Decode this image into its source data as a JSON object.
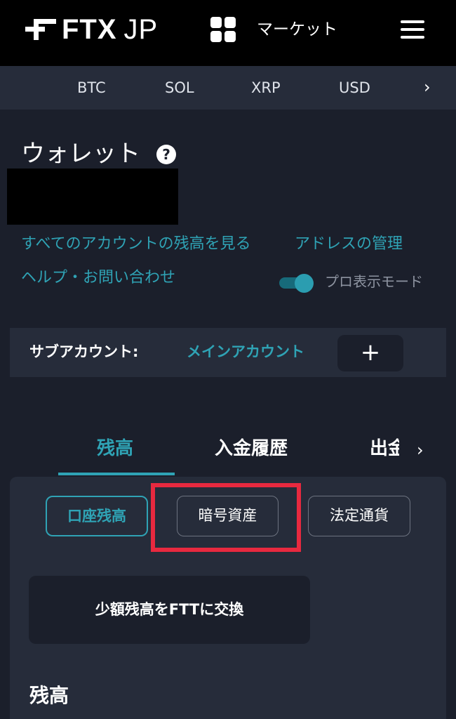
{
  "header": {
    "logo_text": "FTX",
    "logo_suffix": "JP",
    "market_label": "マーケット"
  },
  "ticker": {
    "items": [
      "BTC",
      "SOL",
      "XRP",
      "USD"
    ],
    "next_symbol": "›"
  },
  "wallet": {
    "title": "ウォレット",
    "help_symbol": "?"
  },
  "links": {
    "view_all_balances": "すべてのアカウントの残高を見る",
    "manage_addresses": "アドレスの管理",
    "help_contact": "ヘルプ・お問い合わせ"
  },
  "pro_mode": {
    "label": "プロ表示モード",
    "enabled": true
  },
  "subaccount": {
    "label": "サブアカウント:",
    "value": "メインアカウント",
    "add_symbol": "+"
  },
  "tabs": {
    "items": [
      {
        "label": "残高",
        "active": true
      },
      {
        "label": "入金履歴",
        "active": false
      },
      {
        "label": "出金",
        "active": false
      }
    ],
    "next_symbol": "›"
  },
  "filters": {
    "items": [
      {
        "label": "口座残高",
        "active": true
      },
      {
        "label": "暗号資産",
        "active": false
      },
      {
        "label": "法定通貨",
        "active": false
      }
    ]
  },
  "convert_button": "少額残高をFTTに交換",
  "balance_heading": "残高",
  "colors": {
    "accent": "#2fa3b5",
    "background": "#1b1f2b",
    "panel": "#262c3a",
    "highlight": "#e8293f"
  }
}
